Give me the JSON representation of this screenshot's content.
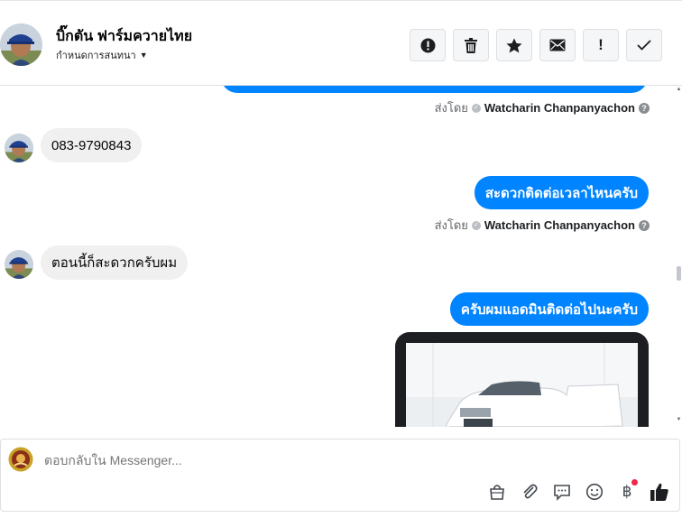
{
  "header": {
    "contact_name": "บิ๊กตัน ฟาร์มควายไทย",
    "assign_label": "กำหนดการสนทนา",
    "toolbar": [
      {
        "name": "spam-button",
        "icon": "alert-circle-icon",
        "glyph": "!"
      },
      {
        "name": "delete-button",
        "icon": "trash-icon",
        "glyph": "🗑"
      },
      {
        "name": "star-button",
        "icon": "star-icon",
        "glyph": "★"
      },
      {
        "name": "mark-unread-button",
        "icon": "envelope-icon",
        "glyph": "✉"
      },
      {
        "name": "follow-up-button",
        "icon": "exclamation-icon",
        "glyph": "!"
      },
      {
        "name": "mark-done-button",
        "icon": "checkmark-icon",
        "glyph": "✓"
      }
    ]
  },
  "messages": {
    "sent_by_label": "ส่งโดย",
    "agent_name": "Watcharin Chanpanyachon",
    "incoming_1": "083-9790843",
    "outgoing_1": "สะดวกติดต่อเวลาไหนครับ",
    "incoming_2": "ตอนนี้ก็สะดวกครับผม",
    "outgoing_2": "ครับผมแอดมินติดต่อไปนะครับ"
  },
  "composer": {
    "placeholder": "ตอบกลับใน Messenger...",
    "tools": [
      {
        "name": "shop-button",
        "icon": "shopping-bag-icon",
        "glyph": "👜"
      },
      {
        "name": "attach-button",
        "icon": "paperclip-icon",
        "glyph": "📎"
      },
      {
        "name": "saved-reply-button",
        "icon": "chat-bubble-icon",
        "glyph": "💬"
      },
      {
        "name": "emoji-button",
        "icon": "smiley-icon",
        "glyph": "☺"
      },
      {
        "name": "payment-button",
        "icon": "baht-icon",
        "glyph": "฿"
      },
      {
        "name": "like-button",
        "icon": "thumbs-up-icon",
        "glyph": "👍"
      }
    ]
  },
  "colors": {
    "outgoing_bubble": "#0084ff",
    "incoming_bubble": "#f0f0f0",
    "notification_dot": "#f02849"
  }
}
